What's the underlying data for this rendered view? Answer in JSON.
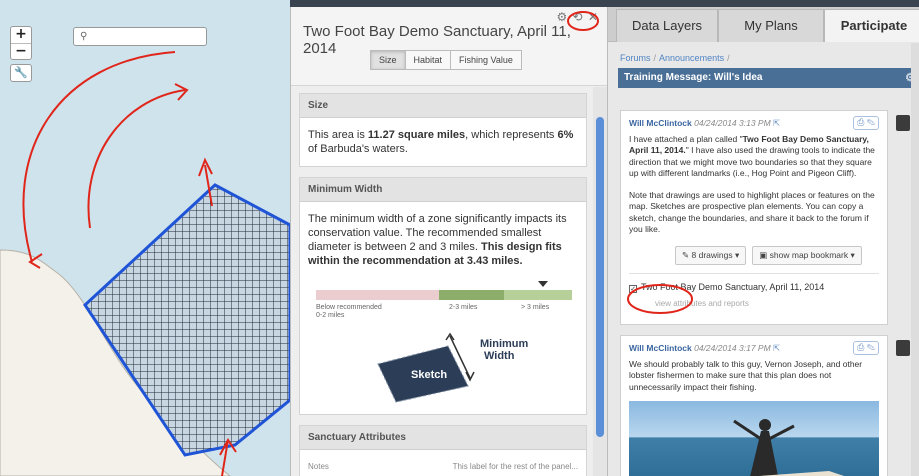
{
  "map": {
    "search_icon": "search-icon",
    "zoom_in": "+",
    "zoom_out": "−",
    "tool_icon": "wrench-icon"
  },
  "report": {
    "title": "Two Foot Bay Demo Sanctuary, April 11, 2014",
    "tools": "⚙ ⟲ ✕",
    "tabs": [
      "Size",
      "Habitat",
      "Fishing Value"
    ],
    "size": {
      "heading": "Size",
      "text_before": "This area is ",
      "area": "11.27 square miles",
      "text_mid": ", which represents ",
      "percent": "6%",
      "text_after": " of Barbuda's waters."
    },
    "min_width": {
      "heading": "Minimum Width",
      "text": "The minimum width of a zone significantly impacts its conservation value. The recommended smallest diameter is between 2 and 3 miles. ",
      "bold": "This design fits within the recommendation at 3.43 miles.",
      "scale_below": "Below recommended",
      "scale_below_sub": "0-2 miles",
      "scale_mid": "2-3 miles",
      "scale_high": "> 3 miles",
      "sketch_label": "Sketch",
      "min_label_1": "Minimum",
      "min_label_2": "Width"
    },
    "attributes": {
      "heading": "Sanctuary Attributes",
      "row_label": "Notes",
      "row_value": "This label for the rest of the panel..."
    }
  },
  "right": {
    "tabs": [
      "Data Layers",
      "My Plans",
      "Participate"
    ],
    "breadcrumb": [
      "Forums",
      "Announcements"
    ],
    "topic": "Training Message: Will's Idea",
    "post1": {
      "author": "Will McClintock",
      "timestamp": "04/24/2014 3:13 PM",
      "p1_a": "I have attached a plan called \"",
      "p1_bold": "Two Foot Bay Demo Sanctuary, April 11, 2014.",
      "p1_b": "\" I have also used the drawing tools to indicate the direction that we might move two boundaries so that they square up with different landmarks (i.e., Hog Point and Pigeon Cliff).",
      "p2": "Note that drawings are used to highlight places or features on the map. Sketches are prospective plan elements. You can copy a sketch, change the boundaries, and share it back to the forum if you like.",
      "drawings_btn": "8 drawings",
      "bookmark_btn": "show map bookmark",
      "attachment": "Two Foot Bay Demo Sanctuary, April 11, 2014",
      "attachment_sub": "view attributes and reports"
    },
    "post2": {
      "author": "Will McClintock",
      "timestamp": "04/24/2014 3:17 PM",
      "text": "We should probably talk to this guy, Vernon Joseph, and other lobster fishermen to make sure that this plan does not unnecessarily impact their fishing."
    }
  },
  "colors": {
    "annotation_red": "#e0261b",
    "sketch_blue": "#1f54d6",
    "water": "#cfe3ec",
    "land": "#f3f1ea",
    "topic_bar": "#4a6f96"
  }
}
